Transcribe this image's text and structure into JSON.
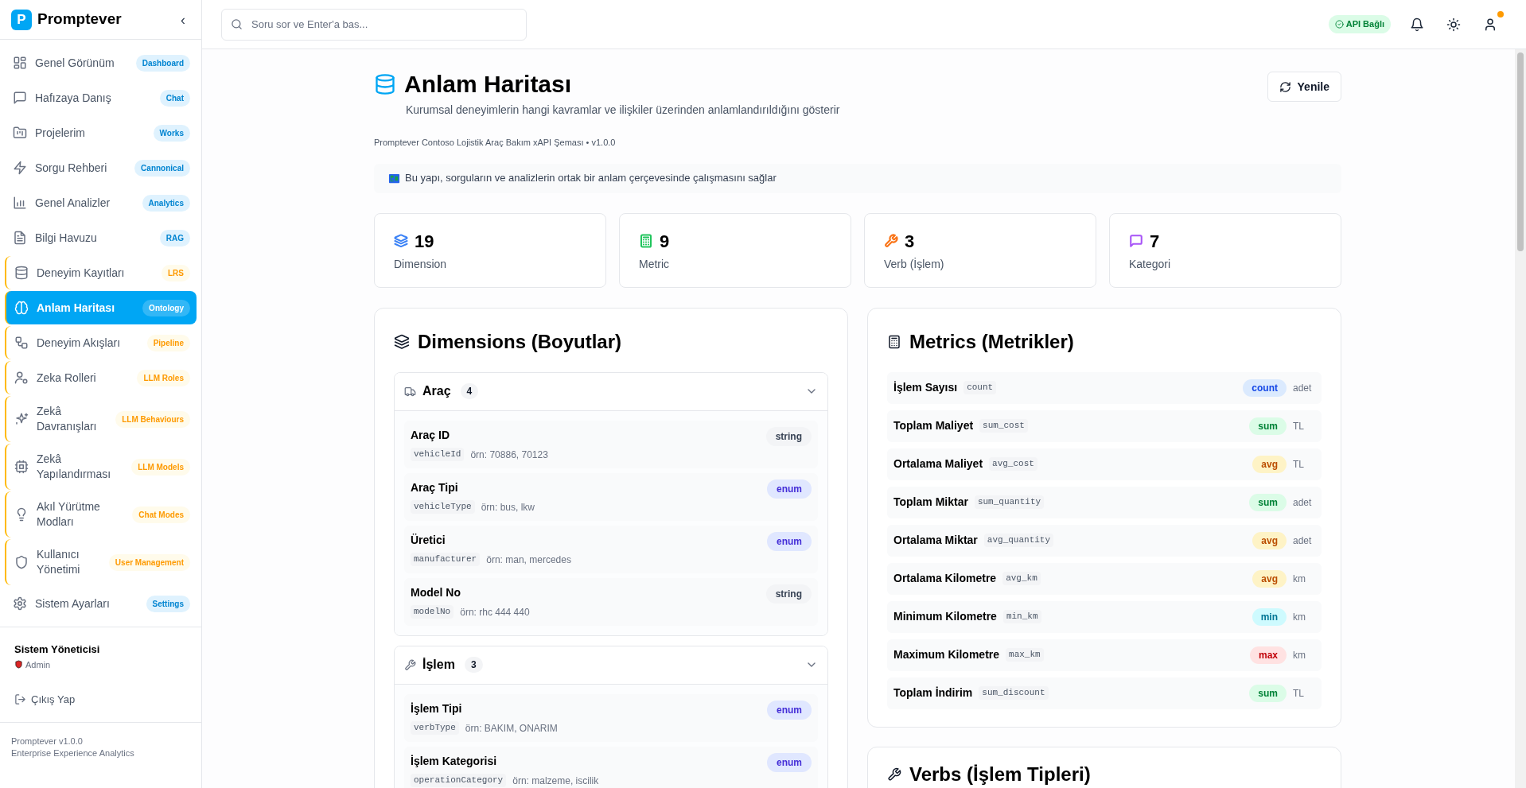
{
  "sidebar": {
    "brand_letter": "P",
    "brand": "Promptever",
    "collapse_glyph": "‹",
    "items": [
      {
        "label": "Genel Görünüm",
        "badge": "Dashboard",
        "kind": "core",
        "selected": false
      },
      {
        "label": "Hafızaya Danış",
        "badge": "Chat",
        "kind": "core",
        "selected": false
      },
      {
        "label": "Projelerim",
        "badge": "Works",
        "kind": "core",
        "selected": false
      },
      {
        "label": "Sorgu Rehberi",
        "badge": "Cannonical",
        "kind": "core",
        "selected": false
      },
      {
        "label": "Genel Analizler",
        "badge": "Analytics",
        "kind": "core",
        "selected": false
      },
      {
        "label": "Bilgi Havuzu",
        "badge": "RAG",
        "kind": "core",
        "selected": false
      },
      {
        "label": "Deneyim Kayıtları",
        "badge": "LRS",
        "kind": "extended",
        "selected": false
      },
      {
        "label": "Anlam Haritası",
        "badge": "Ontology",
        "kind": "extended",
        "selected": true
      },
      {
        "label": "Deneyim Akışları",
        "badge": "Pipeline",
        "kind": "extended",
        "selected": false
      },
      {
        "label": "Zeka Rolleri",
        "badge": "LLM Roles",
        "kind": "extended",
        "selected": false
      },
      {
        "label": "Zekâ Davranışları",
        "badge": "LLM Behaviours",
        "kind": "extended",
        "selected": false
      },
      {
        "label": "Zekâ Yapılandırması",
        "badge": "LLM Models",
        "kind": "extended",
        "selected": false
      },
      {
        "label": "Akıl Yürütme Modları",
        "badge": "Chat Modes",
        "kind": "extended",
        "selected": false
      },
      {
        "label": "Kullanıcı Yönetimi",
        "badge": "User Management",
        "kind": "extended",
        "selected": false
      },
      {
        "label": "Sistem Ayarları",
        "badge": "Settings",
        "kind": "core",
        "selected": false
      }
    ],
    "user": {
      "name": "Sistem Yöneticisi",
      "role": "Admin"
    },
    "logout": "Çıkış Yap",
    "footer": [
      "Promptever v1.0.0",
      "Enterprise Experience Analytics"
    ]
  },
  "header": {
    "search": {
      "placeholder": "Soru sor ve Enter'a bas..."
    },
    "api_status": "API Bağlı",
    "notification_dot": true
  },
  "page": {
    "title": "Anlam Haritası",
    "subtitle": "Kurumsal deneyimlerin hangi kavramlar ve ilişkiler üzerinden anlamlandırıldığını gösterir",
    "schema": "Promptever Contoso Lojistik Araç Bakım xAPI Şeması • v1.0.0",
    "info": "Bu yapı, sorguların ve analizlerin ortak bir anlam çerçevesinde çalışmasını sağlar",
    "refresh": "Yenile"
  },
  "stats": [
    {
      "value": "19",
      "label": "Dimension",
      "color": "#3b82f6"
    },
    {
      "value": "9",
      "label": "Metric",
      "color": "#22c55e"
    },
    {
      "value": "3",
      "label": "Verb (İşlem)",
      "color": "#f97316"
    },
    {
      "value": "7",
      "label": "Kategori",
      "color": "#a855f7"
    }
  ],
  "dimensions": {
    "title": "Dimensions (Boyutlar)",
    "groups": [
      {
        "name": "Araç",
        "count": "4",
        "expanded": true,
        "fields": [
          {
            "label": "Araç ID",
            "key": "vehicleId",
            "example": "örn: 70886, 70123",
            "type": "string"
          },
          {
            "label": "Araç Tipi",
            "key": "vehicleType",
            "example": "örn: bus, lkw",
            "type": "enum"
          },
          {
            "label": "Üretici",
            "key": "manufacturer",
            "example": "örn: man, mercedes",
            "type": "enum"
          },
          {
            "label": "Model No",
            "key": "modelNo",
            "example": "örn: rhc 444 440",
            "type": "string"
          }
        ]
      },
      {
        "name": "İşlem",
        "count": "3",
        "expanded": true,
        "fields": [
          {
            "label": "İşlem Tipi",
            "key": "verbType",
            "example": "örn: BAKIM, ONARIM",
            "type": "enum"
          },
          {
            "label": "İşlem Kategorisi",
            "key": "operationCategory",
            "example": "örn: malzeme, iscilik",
            "type": "enum"
          }
        ]
      }
    ]
  },
  "metrics": {
    "title": "Metrics (Metrikler)",
    "rows": [
      {
        "name": "İşlem Sayısı",
        "key": "count",
        "aggregation": "count",
        "unit": "adet"
      },
      {
        "name": "Toplam Maliyet",
        "key": "sum_cost",
        "aggregation": "sum",
        "unit": "TL"
      },
      {
        "name": "Ortalama Maliyet",
        "key": "avg_cost",
        "aggregation": "avg",
        "unit": "TL"
      },
      {
        "name": "Toplam Miktar",
        "key": "sum_quantity",
        "aggregation": "sum",
        "unit": "adet"
      },
      {
        "name": "Ortalama Miktar",
        "key": "avg_quantity",
        "aggregation": "avg",
        "unit": "adet"
      },
      {
        "name": "Ortalama Kilometre",
        "key": "avg_km",
        "aggregation": "avg",
        "unit": "km"
      },
      {
        "name": "Minimum Kilometre",
        "key": "min_km",
        "aggregation": "min",
        "unit": "km"
      },
      {
        "name": "Maximum Kilometre",
        "key": "max_km",
        "aggregation": "max",
        "unit": "km"
      },
      {
        "name": "Toplam İndirim",
        "key": "sum_discount",
        "aggregation": "sum",
        "unit": "TL"
      }
    ]
  },
  "verbs": {
    "title": "Verbs (İşlem Tipleri)"
  }
}
